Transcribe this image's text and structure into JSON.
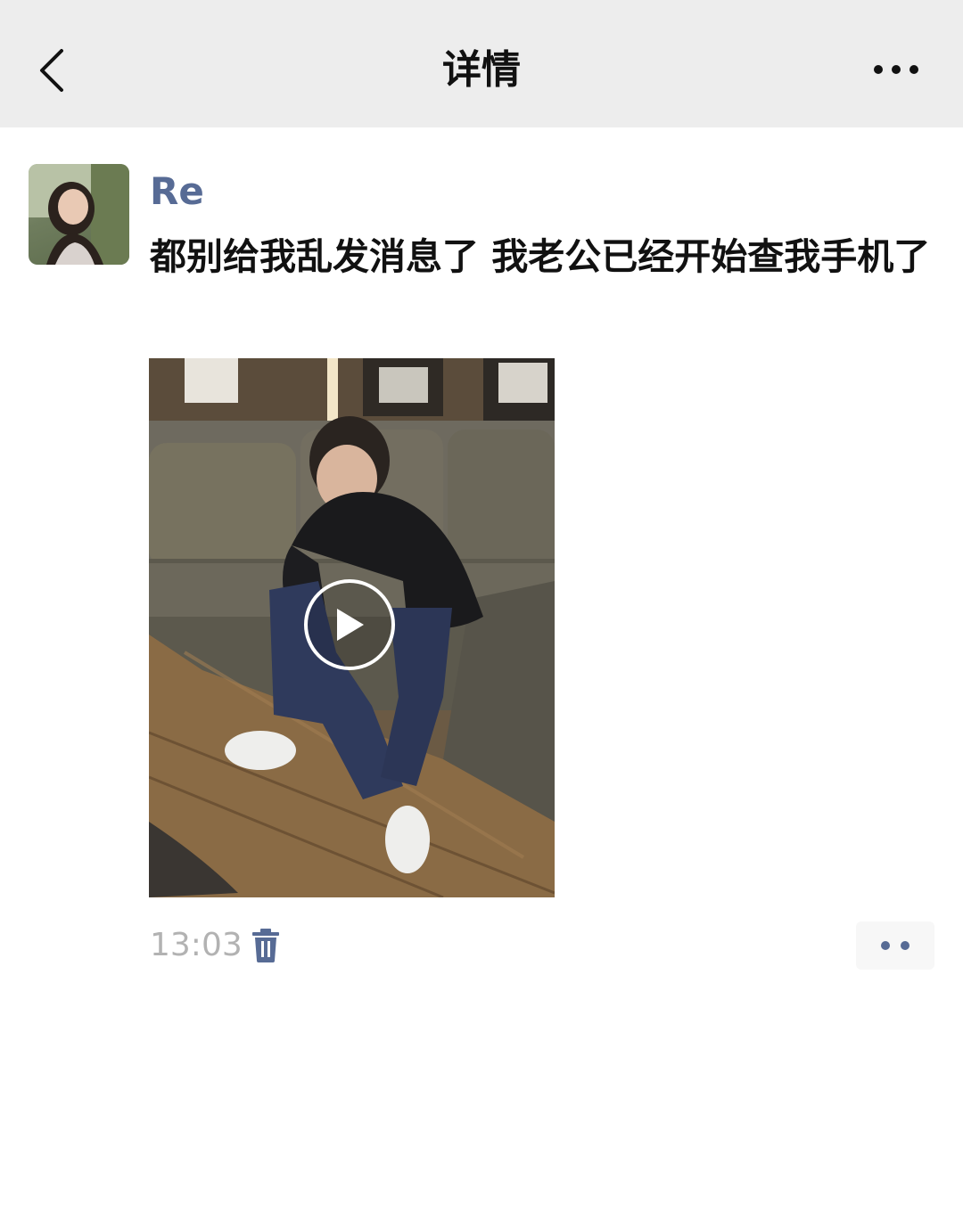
{
  "navbar": {
    "title": "详情",
    "back_icon": "chevron-left-icon",
    "more_icon": "more-horizontal-icon"
  },
  "post": {
    "author": "Re",
    "text": "都别给我乱发消息了 我老公已经开始查我手机了",
    "time": "13:03",
    "media": {
      "type": "video",
      "play_icon": "play-icon"
    },
    "delete_icon": "trash-icon",
    "action_icon": "comment-like-dots-icon"
  },
  "colors": {
    "navbar_bg": "#ededed",
    "name_link": "#576b95",
    "timestamp": "#b2b2b2",
    "text": "#111111"
  }
}
